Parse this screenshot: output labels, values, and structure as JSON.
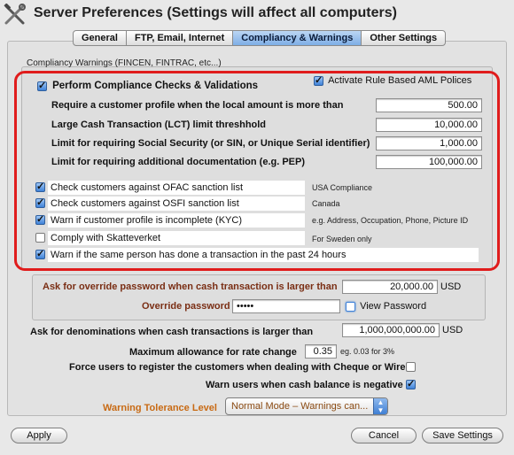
{
  "window": {
    "title": "Server Preferences  (Settings will affect all computers)"
  },
  "icons": {
    "app": "tools-icon",
    "checkbox": "checkmark-icon",
    "dropdown": "updown-arrows-icon"
  },
  "tabs": [
    {
      "label": "General"
    },
    {
      "label": "FTP, Email, Internet"
    },
    {
      "label": "Compliancy & Warnings"
    },
    {
      "label": "Other Settings"
    }
  ],
  "active_tab": "Compliancy & Warnings",
  "group_label": "Compliancy Warnings (FINCEN, FINTRAC, etc...)",
  "perform_checks": {
    "label": "Perform Compliance Checks & Validations",
    "checked": true
  },
  "aml_policies": {
    "label": "Activate Rule Based AML Polices",
    "checked": true
  },
  "thresholds": [
    {
      "label": "Require a customer profile when the local amount is more than",
      "value": "500.00"
    },
    {
      "label": "Large Cash Transaction (LCT) limit threshhold",
      "value": "10,000.00"
    },
    {
      "label": "Limit for requiring Social Security (or SIN, or Unique Serial identifier)",
      "value": "1,000.00"
    },
    {
      "label": "Limit for requiring additional documentation (e.g. PEP)",
      "value": "100,000.00"
    }
  ],
  "checks": [
    {
      "label": "Check customers against OFAC sanction list",
      "checked": true,
      "note": "USA Compliance"
    },
    {
      "label": "Check customers against OSFI sanction list",
      "checked": true,
      "note": "Canada"
    },
    {
      "label": "Warn if customer profile is incomplete (KYC)",
      "checked": true,
      "note": "e.g. Address, Occupation, Phone, Picture ID"
    },
    {
      "label": "Comply with Skatteverket",
      "checked": false,
      "note": "For Sweden only"
    },
    {
      "label": "Warn if the same person has done a transaction in the past 24 hours",
      "checked": true,
      "note": ""
    }
  ],
  "override": {
    "label": "Ask for override password when cash transaction is larger than",
    "value": "20,000.00",
    "unit": "USD",
    "password_label": "Override password",
    "password_value": "•••••",
    "view_password_label": "View Password",
    "view_password_checked": false
  },
  "denominations": {
    "label": "Ask for denominations when cash transactions is larger than",
    "value": "1,000,000,000.00",
    "unit": "USD"
  },
  "rate_change": {
    "label": "Maximum allowance for rate change",
    "value": "0.35",
    "hint": "eg. 0.03 for 3%"
  },
  "force_register": {
    "label": "Force users to register the customers when dealing with Cheque or Wire",
    "checked": false
  },
  "warn_cash": {
    "label": "Warn users when cash balance is negative",
    "checked": true
  },
  "tolerance": {
    "label": "Warning Tolerance Level",
    "value": "Normal Mode – Warnings can..."
  },
  "buttons": {
    "apply": "Apply",
    "cancel": "Cancel",
    "save": "Save Settings"
  },
  "colors": {
    "highlight": "#e01c1c",
    "accent": "#3f82d8",
    "label_brown": "#7a2e14",
    "tolerance_orange": "#c86a14"
  }
}
